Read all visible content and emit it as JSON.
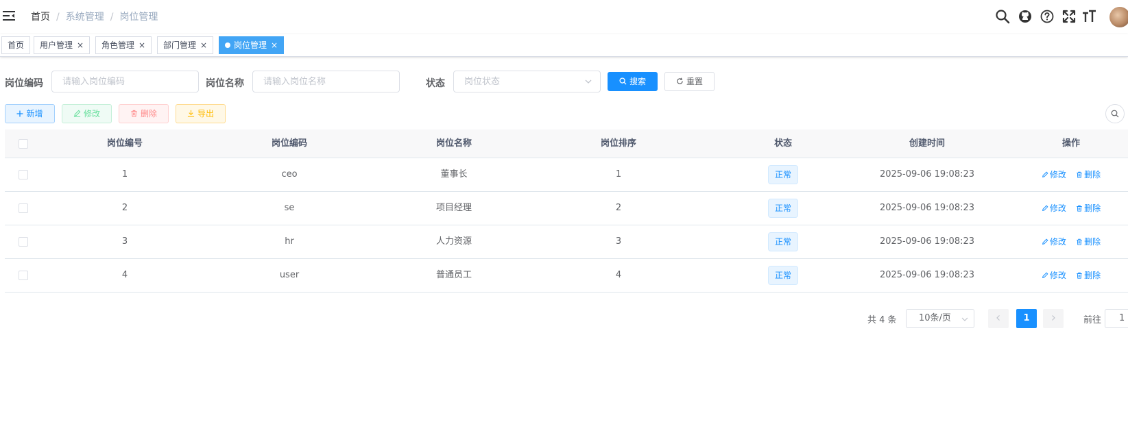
{
  "navbar": {
    "breadcrumb": [
      "首页",
      "系统管理",
      "岗位管理"
    ],
    "breadcrumb_separator": "/",
    "icons": [
      "hamburger-icon",
      "search-icon",
      "github-icon",
      "question-icon",
      "fullscreen-icon",
      "font-size-icon",
      "avatar"
    ]
  },
  "tags": [
    {
      "label": "首页",
      "closable": false,
      "active": false
    },
    {
      "label": "用户管理",
      "closable": true,
      "active": false
    },
    {
      "label": "角色管理",
      "closable": true,
      "active": false
    },
    {
      "label": "部门管理",
      "closable": true,
      "active": false
    },
    {
      "label": "岗位管理",
      "closable": true,
      "active": true
    }
  ],
  "tag_close": "×",
  "search": {
    "post_code_label": "岗位编码",
    "post_code_placeholder": "请输入岗位编码",
    "post_name_label": "岗位名称",
    "post_name_placeholder": "请输入岗位名称",
    "status_label": "状态",
    "status_placeholder": "岗位状态",
    "search_button": "搜索",
    "reset_button": "重置"
  },
  "toolbar": {
    "add": "新增",
    "edit": "修改",
    "delete": "删除",
    "export": "导出"
  },
  "table": {
    "headers": [
      "岗位编号",
      "岗位编码",
      "岗位名称",
      "岗位排序",
      "状态",
      "创建时间",
      "操作"
    ],
    "rows": [
      {
        "id": "1",
        "code": "ceo",
        "name": "董事长",
        "sort": "1",
        "status": "正常",
        "created": "2025-09-06 19:08:23"
      },
      {
        "id": "2",
        "code": "se",
        "name": "项目经理",
        "sort": "2",
        "status": "正常",
        "created": "2025-09-06 19:08:23"
      },
      {
        "id": "3",
        "code": "hr",
        "name": "人力资源",
        "sort": "3",
        "status": "正常",
        "created": "2025-09-06 19:08:23"
      },
      {
        "id": "4",
        "code": "user",
        "name": "普通员工",
        "sort": "4",
        "status": "正常",
        "created": "2025-09-06 19:08:23"
      }
    ],
    "op_edit": "修改",
    "op_delete": "删除"
  },
  "pagination": {
    "total": "共 4 条",
    "page_size": "10条/页",
    "current_page": "1",
    "goto_label": "前往",
    "goto_value": "1"
  },
  "colors": {
    "primary": "#1890ff",
    "active_tag": "#42a5f5",
    "success": "#13ce66",
    "danger": "#ff4949",
    "warning": "#ffba00"
  }
}
